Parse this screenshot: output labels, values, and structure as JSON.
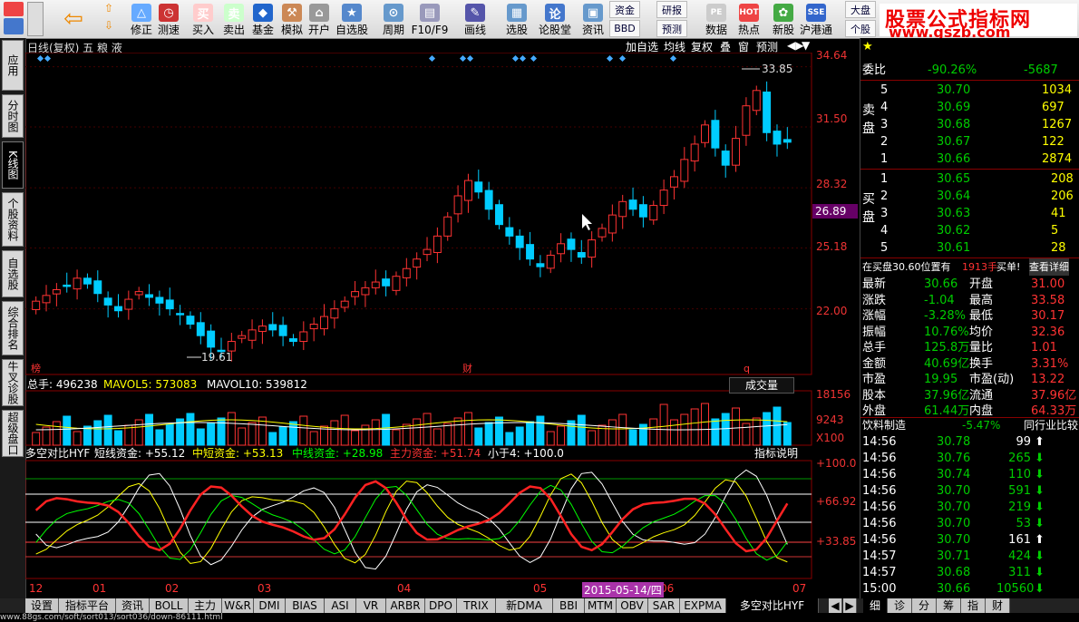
{
  "toolbar": {
    "items": [
      {
        "label": "修正",
        "icon": "△"
      },
      {
        "label": "测速",
        "icon": "◷"
      },
      {
        "label": "买入",
        "icon": "买"
      },
      {
        "label": "卖出",
        "icon": "卖"
      },
      {
        "label": "基金",
        "icon": "◆"
      },
      {
        "label": "模拟",
        "icon": "⚒"
      },
      {
        "label": "开户",
        "icon": "⌂"
      },
      {
        "label": "自选股",
        "icon": "★"
      },
      {
        "label": "周期",
        "icon": "⊙"
      },
      {
        "label": "F10/F9",
        "icon": "▤"
      },
      {
        "label": "画线",
        "icon": "✎"
      },
      {
        "label": "选股",
        "icon": "▦"
      },
      {
        "label": "论股堂",
        "icon": "论"
      },
      {
        "label": "资讯",
        "icon": "▣"
      },
      {
        "label": "数据",
        "icon": "PE"
      },
      {
        "label": "热点",
        "icon": "HOT"
      },
      {
        "label": "新股",
        "icon": "✿"
      },
      {
        "label": "沪港通",
        "icon": "SSE"
      }
    ],
    "pair1": [
      "资金",
      "BBD"
    ],
    "pair2": [
      "研报",
      "预测"
    ],
    "pair3": [
      "大盘",
      "个股"
    ]
  },
  "brand": {
    "title": "股票公式指标网",
    "url": "www.gszb.com"
  },
  "left_tabs": [
    "应用",
    "分时图",
    "K线图",
    "个股资料",
    "自选股",
    "综合排名",
    "牛叉诊股",
    "超级盘口"
  ],
  "chart": {
    "name": "日线(复权)  五 粮 液",
    "buttons": [
      "加自选",
      "均线",
      "复权",
      "叠",
      "窗",
      "预测"
    ],
    "price_scale": [
      "34.64",
      "31.50",
      "28.32",
      "26.89",
      "25.18",
      "22.00"
    ],
    "max_label": "33.85",
    "min_label": "19.61",
    "markers": [
      "榜",
      "财",
      "q"
    ],
    "vol_bar": {
      "total": "总手: 496238",
      "mavol5": "MAVOL5: 573083",
      "mavol10": "MAVOL10: 539812",
      "btn": "成交量"
    },
    "vol_scale": [
      "18156",
      "9243",
      "X100"
    ],
    "ind_bar": {
      "name": "多空对比HYF",
      "short": "短线资金: +55.12",
      "mid_short": "中短资金: +53.13",
      "mid": "中线资金: +28.98",
      "main": "主力资金: +51.74",
      "small": "小于4: +100.0",
      "btn": "指标说明"
    },
    "ind_scale": [
      "+100.0",
      "+66.92",
      "+33.85"
    ],
    "x_labels": [
      "12",
      "01",
      "02",
      "03",
      "04",
      "05",
      "06",
      "07"
    ],
    "date_label": "2015-05-14/四"
  },
  "chart_data": {
    "type": "candlestick",
    "title": "五 粮 液",
    "ylim": [
      19.0,
      35.0
    ],
    "max": 33.85,
    "min": 19.61,
    "close": [
      22.4,
      22.7,
      23.0,
      23.2,
      23.6,
      23.3,
      22.8,
      22.2,
      21.9,
      22.5,
      22.9,
      22.6,
      22.3,
      22.0,
      21.7,
      21.2,
      20.6,
      20.0,
      19.8,
      20.3,
      20.6,
      20.9,
      21.1,
      20.9,
      20.6,
      20.3,
      20.8,
      21.2,
      21.6,
      22.0,
      22.4,
      22.9,
      23.1,
      23.4,
      23.2,
      23.7,
      24.1,
      24.6,
      25.1,
      25.8,
      26.8,
      27.9,
      28.7,
      28.1,
      27.2,
      26.4,
      25.8,
      25.2,
      24.6,
      24.2,
      24.8,
      25.4,
      25.1,
      24.7,
      25.6,
      26.2,
      26.9,
      27.6,
      27.2,
      26.8,
      27.4,
      28.2,
      28.9,
      29.8,
      30.6,
      31.6,
      30.4,
      29.5,
      30.9,
      32.6,
      33.4,
      31.2,
      30.6,
      30.7
    ],
    "current_price": "26.89"
  },
  "quote": {
    "wei_bi": {
      "label": "委比",
      "pct": "-90.26%",
      "diff": "-5687"
    },
    "sell": [
      [
        "5",
        "30.70",
        "1034"
      ],
      [
        "4",
        "30.69",
        "697"
      ],
      [
        "3",
        "30.68",
        "1267"
      ],
      [
        "2",
        "30.67",
        "122"
      ],
      [
        "1",
        "30.66",
        "2874"
      ]
    ],
    "buy": [
      [
        "1",
        "30.65",
        "208"
      ],
      [
        "2",
        "30.64",
        "206"
      ],
      [
        "3",
        "30.63",
        "41"
      ],
      [
        "4",
        "30.62",
        "5"
      ],
      [
        "5",
        "30.61",
        "28"
      ]
    ],
    "sell_label": "卖盘",
    "buy_label": "买盘",
    "note": "在买盘30.60位置有",
    "note_qty": "1913手",
    "note_buy": "买单!",
    "note_detail": "查看详细",
    "stats": [
      [
        "最新",
        "30.66",
        "开盘",
        "31.00"
      ],
      [
        "涨跌",
        "-1.04",
        "最高",
        "33.58"
      ],
      [
        "涨幅",
        "-3.28%",
        "最低",
        "30.17"
      ],
      [
        "振幅",
        "10.76%",
        "均价",
        "32.36"
      ],
      [
        "总手",
        "125.8万",
        "量比",
        "1.01"
      ],
      [
        "金额",
        "40.69亿",
        "换手",
        "3.31%"
      ],
      [
        "市盈",
        "19.95",
        "市盈(动)",
        "13.22"
      ],
      [
        "股本",
        "37.96亿",
        "流通",
        "37.96亿"
      ],
      [
        "外盘",
        "61.44万",
        "内盘",
        "64.33万"
      ]
    ],
    "industry": {
      "name": "饮料制造",
      "pct": "-5.47%",
      "btn": "同行业比较"
    },
    "ticks": [
      [
        "14:56",
        "30.78",
        "99",
        "up"
      ],
      [
        "14:56",
        "30.76",
        "265",
        "down"
      ],
      [
        "14:56",
        "30.74",
        "110",
        "down"
      ],
      [
        "14:56",
        "30.70",
        "591",
        "down"
      ],
      [
        "14:56",
        "30.70",
        "219",
        "down"
      ],
      [
        "14:56",
        "30.70",
        "53",
        "down"
      ],
      [
        "14:56",
        "30.70",
        "161",
        "up"
      ],
      [
        "14:57",
        "30.71",
        "424",
        "down"
      ],
      [
        "14:57",
        "30.68",
        "311",
        "down"
      ],
      [
        "15:00",
        "30.66",
        "10560",
        "down"
      ]
    ]
  },
  "bottom_tabs": [
    "设置",
    "指标平台",
    "资讯",
    "BOLL",
    "主力",
    "W&R",
    "DMI",
    "BIAS",
    "ASI",
    "VR",
    "ARBR",
    "DPO",
    "TRIX",
    "新DMA",
    "BBI",
    "MTM",
    "OBV",
    "SAR",
    "EXPMA",
    "多空对比HYF"
  ],
  "right_tabs": [
    "细",
    "诊",
    "分",
    "筹",
    "指",
    "财"
  ],
  "status_url": "www.88gs.com/soft/sort013/sort036/down-86111.html"
}
